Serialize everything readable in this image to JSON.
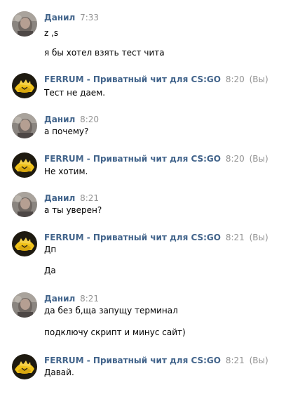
{
  "groups": [
    {
      "author": "Данил",
      "avatar": "user-photo-avatar",
      "time": "7:33",
      "suffix": "",
      "messages": [
        "z ,s",
        "я бы хотел взять тест чита"
      ]
    },
    {
      "author": "FERRUM - Приватный чит для CS:GO",
      "avatar": "ferrum-logo-avatar",
      "time": "8:20",
      "suffix": "(Вы)",
      "messages": [
        "Тест не даем."
      ]
    },
    {
      "author": "Данил",
      "avatar": "user-photo-avatar",
      "time": "8:20",
      "suffix": "",
      "messages": [
        "а почему?"
      ]
    },
    {
      "author": "FERRUM - Приватный чит для CS:GO",
      "avatar": "ferrum-logo-avatar",
      "time": "8:20",
      "suffix": "(Вы)",
      "messages": [
        "Не хотим."
      ]
    },
    {
      "author": "Данил",
      "avatar": "user-photo-avatar",
      "time": "8:21",
      "suffix": "",
      "messages": [
        "а ты уверен?"
      ]
    },
    {
      "author": "FERRUM - Приватный чит для CS:GO",
      "avatar": "ferrum-logo-avatar",
      "time": "8:21",
      "suffix": "(Вы)",
      "messages": [
        "Дп",
        "Да"
      ]
    },
    {
      "author": "Данил",
      "avatar": "user-photo-avatar",
      "time": "8:21",
      "suffix": "",
      "messages": [
        "да без б,ща запущу терминал",
        "подключу скрипт и минус сайт)"
      ]
    },
    {
      "author": "FERRUM - Приватный чит для CS:GO",
      "avatar": "ferrum-logo-avatar",
      "time": "8:21",
      "suffix": "(Вы)",
      "messages": [
        "Давай."
      ]
    }
  ],
  "colors": {
    "author": "#42648b",
    "meta": "#939393",
    "text": "#000000",
    "background": "#ffffff"
  }
}
